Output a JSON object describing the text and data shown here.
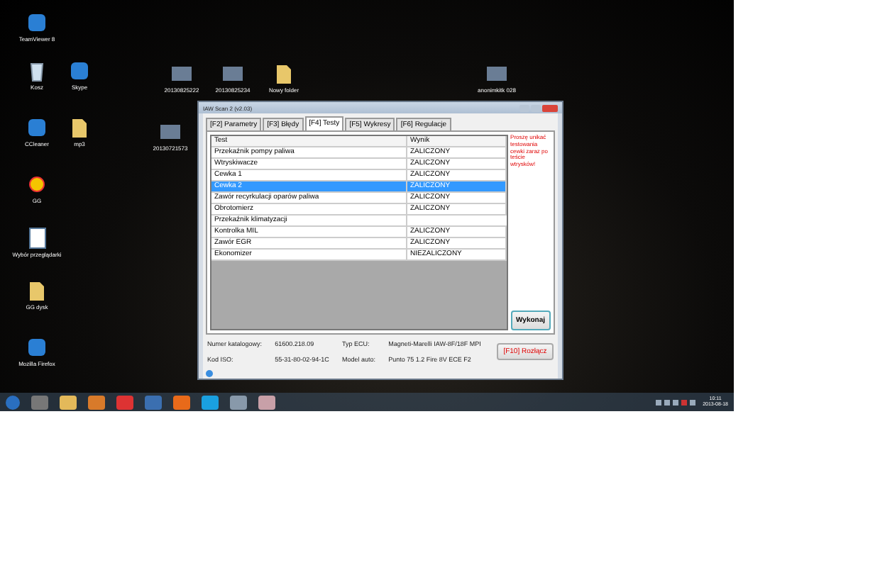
{
  "desktop_icons": [
    {
      "label": "TeamViewer 8",
      "kind": "app"
    },
    {
      "label": "Kosz",
      "kind": "bin"
    },
    {
      "label": "CCleaner",
      "kind": "app"
    },
    {
      "label": "GG",
      "kind": "sun"
    },
    {
      "label": "Wybór przeglądarki",
      "kind": "doc"
    },
    {
      "label": "GG dysk",
      "kind": "folder"
    },
    {
      "label": "Mozilla Firefox",
      "kind": "app"
    },
    {
      "label": "Skype",
      "kind": "app"
    },
    {
      "label": "mp3",
      "kind": "folder"
    },
    {
      "label": "20130825222",
      "kind": "photo"
    },
    {
      "label": "20130825234",
      "kind": "photo"
    },
    {
      "label": "Nowy folder",
      "kind": "folder"
    },
    {
      "label": "20130721573",
      "kind": "photo"
    },
    {
      "label": "anonimkitk 028",
      "kind": "photo"
    }
  ],
  "window": {
    "title": "IAW Scan 2 (v2.03)"
  },
  "tabs": [
    {
      "label": "[F2] Parametry",
      "selected": false
    },
    {
      "label": "[F3] Błędy",
      "selected": false
    },
    {
      "label": "[F4] Testy",
      "selected": true
    },
    {
      "label": "[F5] Wykresy",
      "selected": false
    },
    {
      "label": "[F6] Regulacje",
      "selected": false
    }
  ],
  "table": {
    "columns": [
      "Test",
      "Wynik"
    ],
    "rows": [
      {
        "test": "Przekaźnik pompy paliwa",
        "result": "ZALICZONY",
        "selected": false
      },
      {
        "test": "Wtryskiwacze",
        "result": "ZALICZONY",
        "selected": false
      },
      {
        "test": "Cewka 1",
        "result": "ZALICZONY",
        "selected": false
      },
      {
        "test": "Cewka 2",
        "result": "ZALICZONY",
        "selected": true
      },
      {
        "test": "Zawór recyrkulacji oparów paliwa",
        "result": "ZALICZONY",
        "selected": false
      },
      {
        "test": "Obrotomierz",
        "result": "ZALICZONY",
        "selected": false
      },
      {
        "test": "Przekaźnik klimatyzacji",
        "selected": false
      },
      {
        "test": "Kontrolka MIL",
        "result": "ZALICZONY",
        "selected": false
      },
      {
        "test": "Zawór EGR",
        "result": "ZALICZONY",
        "selected": false
      },
      {
        "test": "Ekonomizer",
        "result": "NIEZALICZONY",
        "selected": false
      }
    ]
  },
  "note": "Proszę unikać testowania cewki zaraz po teście wtrysków!",
  "run_button": "Wykonaj",
  "info": [
    {
      "label": "Numer katalogowy:",
      "value": "61600.218.09"
    },
    {
      "label": "Typ ECU:",
      "value": "Magneti-Marelli IAW-8F/18F MPI"
    },
    {
      "label": "Kod ISO:",
      "value": "55-31-80-02-94-1C"
    },
    {
      "label": "Model auto:",
      "value": "Punto 75 1.2 Fire 8V ECE F2"
    }
  ],
  "disconnect_button": "[F10] Rozłącz",
  "clock": {
    "time": "10:11",
    "date": "2013-08-18"
  }
}
